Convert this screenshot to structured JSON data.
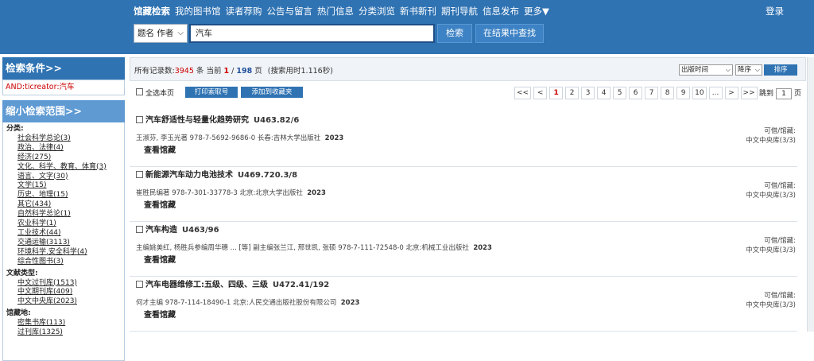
{
  "nav": {
    "items": [
      "馆藏检索",
      "我的图书馆",
      "读者荐购",
      "公告与留言",
      "热门信息",
      "分类浏览",
      "新书新刊",
      "期刊导航",
      "信息发布",
      "更多▼"
    ],
    "login": "登录"
  },
  "search": {
    "field": "题名 作者",
    "query": "汽车",
    "search_btn": "检索",
    "within_btn": "在结果中查找"
  },
  "sidebar": {
    "conditions_title": "检索条件>>",
    "condition": "AND:ticreator:汽车",
    "narrow_title": "缩小检索范围>>",
    "groups": [
      {
        "title": "分类:",
        "items": [
          "社会科学总论(3)",
          "政治、法律(4)",
          "经济(275)",
          "文化、科学、教育、体育(3)",
          "语言、文字(30)",
          "文学(15)",
          "历史、地理(15)",
          "其它(434)",
          "自然科学总论(1)",
          "农业科学(1)",
          "工业技术(44)",
          "交通运输(3113)",
          "环境科学.安全科学(4)",
          "综合性图书(3)"
        ]
      },
      {
        "title": "文献类型:",
        "items": [
          "中文过刊库(1513)",
          "中文期刊库(409)",
          "中文中央库(2023)"
        ]
      },
      {
        "title": "馆藏地:",
        "items": [
          "密集书库(113)",
          "过刊库(1325)"
        ]
      }
    ]
  },
  "summary": {
    "label_total": "所有记录数:",
    "total": "3945",
    "label_unit": "条 当前",
    "current": "1",
    "sep": "/",
    "pages": "198",
    "label_pages": "页",
    "timing": "(搜索用时1.116秒)",
    "sort_field": "出版时间",
    "sort_order": "降序",
    "sort_btn": "排序"
  },
  "toolbar": {
    "select_all": "全选本页",
    "print_btn": "打印索取号",
    "fav_btn": "添加到收藏夹",
    "pager": [
      "<<",
      "<",
      "1",
      "2",
      "3",
      "4",
      "5",
      "6",
      "7",
      "8",
      "9",
      "10",
      "...",
      ">",
      ">>"
    ],
    "jump_label": "跳到",
    "jump_value": "1",
    "jump_unit": "页"
  },
  "records": [
    {
      "title": "汽车舒适性与轻量化趋势研究",
      "callno": "U463.82/6",
      "meta": "王淑芬, 李玉光著   978-7-5692-9686-0  长春:吉林大学出版社",
      "year": "2023",
      "link": "查看馆藏",
      "avail1": "可借/馆藏:",
      "avail2": "中文中央库(3/3)"
    },
    {
      "title": "新能源汽车动力电池技术",
      "callno": "U469.720.3/8",
      "meta": "崔胜民编著   978-7-301-33778-3  北京:北京大学出版社",
      "year": "2023",
      "link": "查看馆藏",
      "avail1": "可借/馆藏:",
      "avail2": "中文中央库(3/3)"
    },
    {
      "title": "汽车构造",
      "callno": "U463/96",
      "meta": "主编姚美红, 杨胜兵参编周华穗 ... [等] 副主编张兰江, 邢世凯, 张硕   978-7-111-72548-0  北京:机械工业出版社",
      "year": "2023",
      "link": "查看馆藏",
      "avail1": "可借/馆藏:",
      "avail2": "中文中央库(3/3)"
    },
    {
      "title": "汽车电器维修工:五级、四级、三级",
      "callno": "U472.41/192",
      "meta": "何才主编   978-7-114-18490-1  北京:人民交通出版社股份有限公司",
      "year": "2023",
      "link": "查看馆藏",
      "avail1": "可借/馆藏:",
      "avail2": "中文中央库(3/3)"
    }
  ]
}
